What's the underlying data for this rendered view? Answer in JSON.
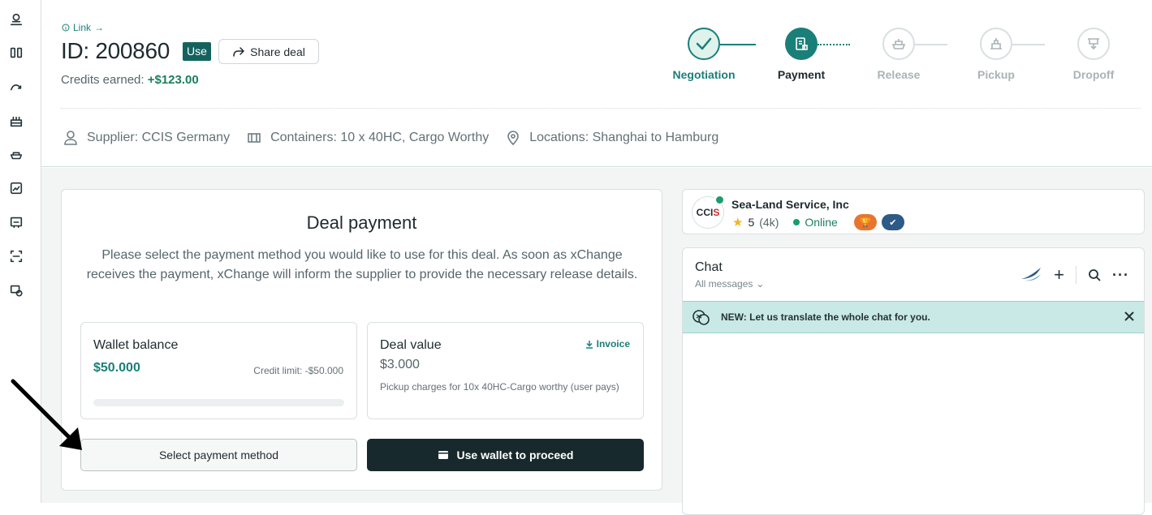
{
  "sidebar": {
    "icons": [
      "profile-icon",
      "dashboard-icon",
      "analytics-icon",
      "factory-icon",
      "container-icon",
      "trade-icon",
      "inventory-icon",
      "scan-icon",
      "billing-icon"
    ]
  },
  "header": {
    "link_label": "Link",
    "deal_id": "ID: 200860",
    "use_badge": "Use",
    "share_label": "Share deal",
    "credits_label": "Credits earned: ",
    "credits_value": "+$123.00"
  },
  "steps": [
    {
      "label": "Negotiation",
      "state": "done"
    },
    {
      "label": "Payment",
      "state": "active"
    },
    {
      "label": "Release",
      "state": "pending"
    },
    {
      "label": "Pickup",
      "state": "pending"
    },
    {
      "label": "Dropoff",
      "state": "pending"
    }
  ],
  "info": {
    "supplier": "Supplier: CCIS Germany",
    "containers": "Containers: 10 x 40HC, Cargo Worthy",
    "locations": "Locations: Shanghai to Hamburg"
  },
  "payment": {
    "title": "Deal payment",
    "description": "Please select the payment method you would like to use for this deal. As soon as xChange receives the payment, xChange will inform the supplier to provide the necessary release details.",
    "wallet": {
      "title": "Wallet balance",
      "amount": "$50.000",
      "credit_limit": "Credit limit: -$50.000",
      "progress_fraction": 0
    },
    "deal": {
      "title": "Deal value",
      "invoice_label": "Invoice",
      "amount": "$3.000",
      "note": "Pickup charges for 10x 40HC-Cargo worthy (user pays)"
    },
    "select_button": "Select payment method",
    "wallet_button": "Use wallet to proceed"
  },
  "seller": {
    "logo_text": "CCIS",
    "name": "Sea-Land Service, Inc",
    "rating": "5",
    "reviews": "(4k)",
    "status": "Online"
  },
  "chat": {
    "title": "Chat",
    "filter": "All messages",
    "banner": "NEW: Let us translate the whole chat for you."
  },
  "colors": {
    "accent": "#1a7f78",
    "dark_button": "#17292c",
    "banner_bg": "#c9e9e6"
  }
}
